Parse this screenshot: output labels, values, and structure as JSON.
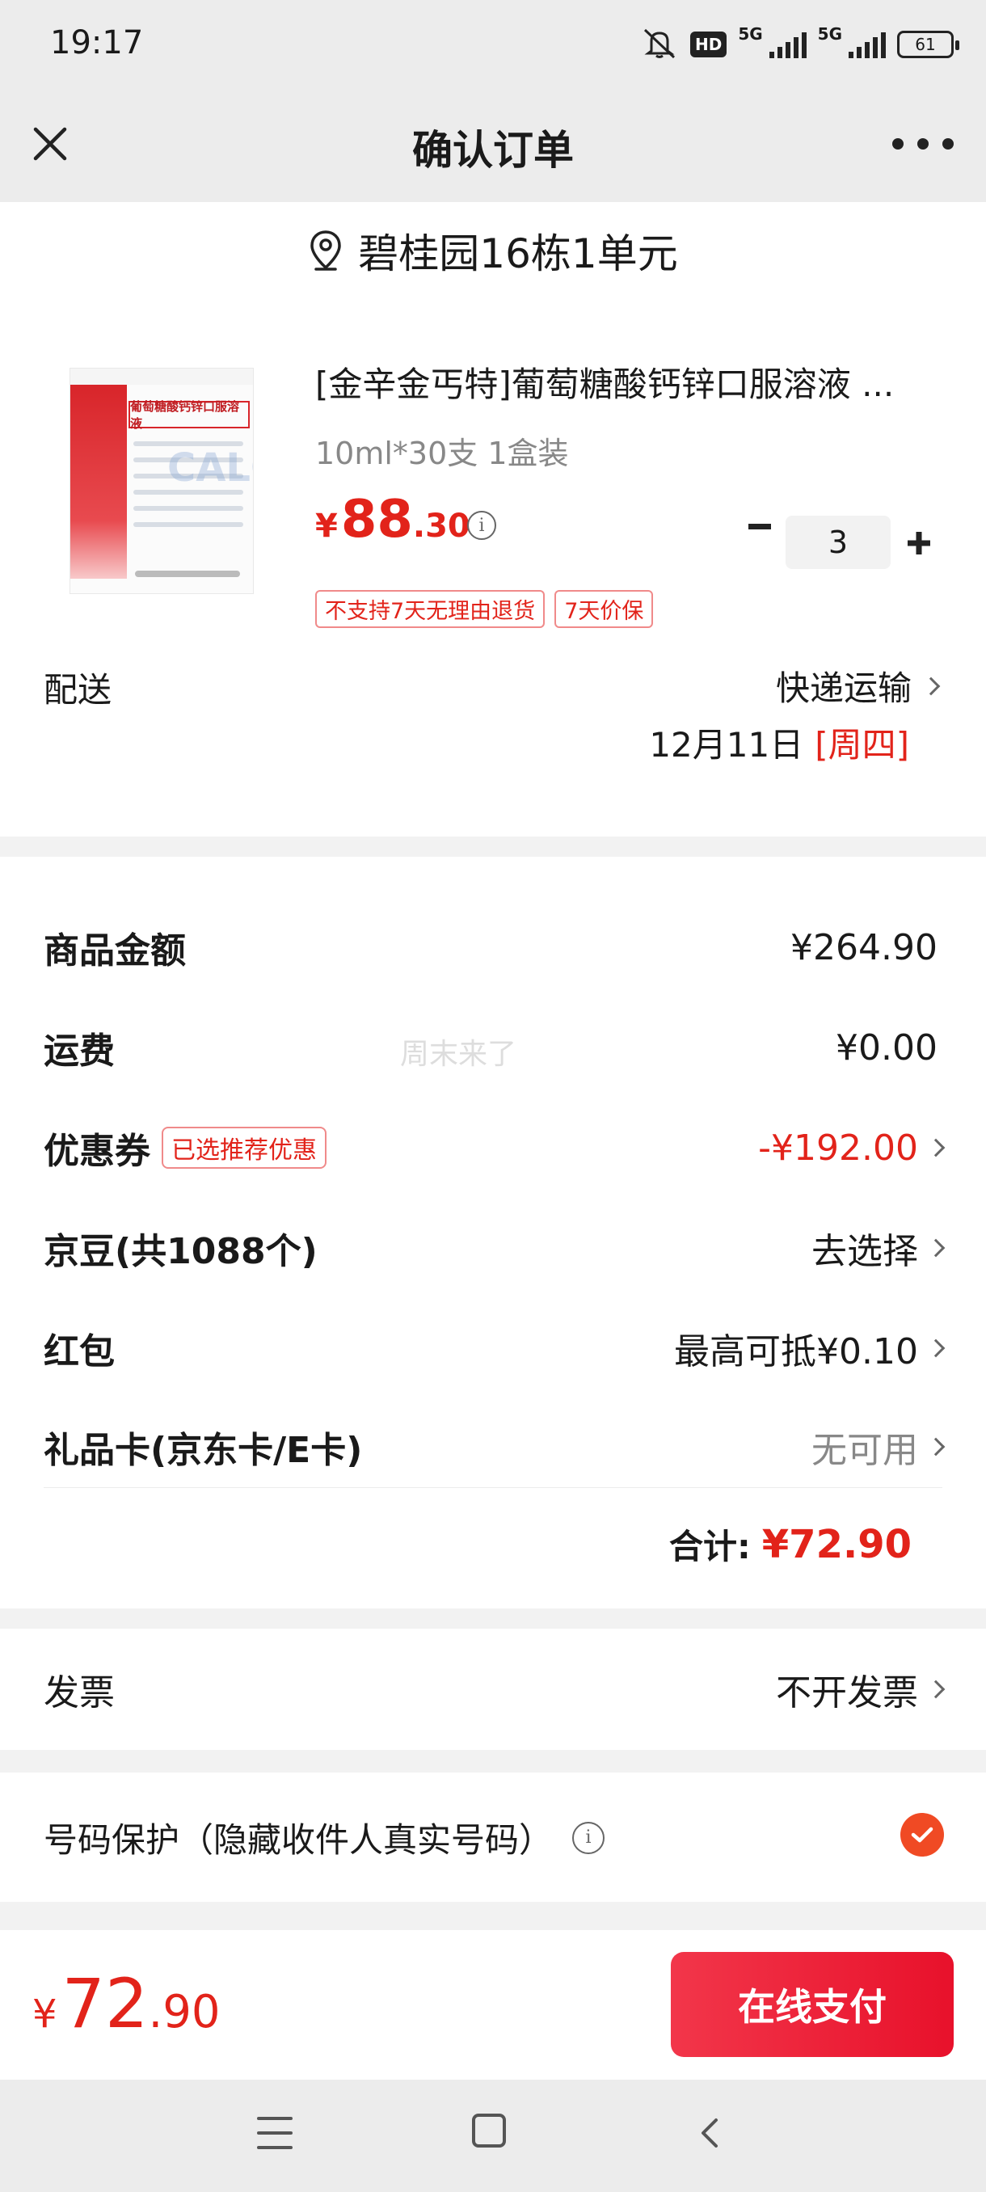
{
  "status_bar": {
    "time": "19:17",
    "hd_badge": "HD",
    "network_1": "5G",
    "network_2": "5G",
    "battery": "61"
  },
  "header": {
    "title": "确认订单"
  },
  "address": {
    "text": "碧桂园16栋1单元"
  },
  "product": {
    "name": "[金辛金丐特]葡萄糖酸钙锌口服溶液 ...",
    "spec": "10ml*30支 1盒装",
    "price_symbol": "¥",
    "price_integer": "88",
    "price_decimal": ".30",
    "quantity": "3",
    "tags": [
      "不支持7天无理由退货",
      "7天价保"
    ]
  },
  "delivery": {
    "label": "配送",
    "method": "快递运输",
    "date": "12月11日",
    "weekday": "[周四]"
  },
  "summary": {
    "goods_amount_label": "商品金额",
    "goods_amount_value": "¥264.90",
    "shipping_label": "运费",
    "shipping_value": "¥0.00",
    "coupon_label": "优惠券",
    "coupon_badge": "已选推荐优惠",
    "coupon_value": "-¥192.00",
    "jingdou_label": "京豆(共1088个)",
    "jingdou_value": "去选择",
    "redpacket_label": "红包",
    "redpacket_value": "最高可抵¥0.10",
    "giftcard_label": "礼品卡(京东卡/E卡)",
    "giftcard_value": "无可用",
    "watermark": "周末来了",
    "total_label": "合计:",
    "total_value": "¥72.90"
  },
  "invoice": {
    "label": "发票",
    "value": "不开发票"
  },
  "privacy": {
    "label": "号码保护（隐藏收件人真实号码）",
    "checked": true
  },
  "pay_bar": {
    "symbol": "¥",
    "integer": "72",
    "decimal": ".90",
    "button_label": "在线支付"
  },
  "colors": {
    "accent_red": "#e2231a",
    "pay_button": "#f2364a",
    "check_orange": "#f04a24"
  }
}
